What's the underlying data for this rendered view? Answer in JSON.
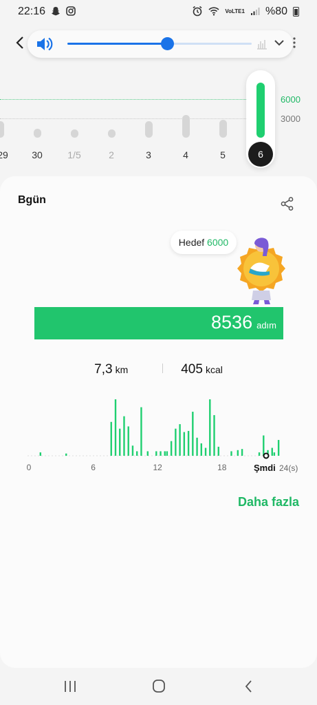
{
  "status_bar": {
    "time": "22:16",
    "notif_icons": [
      "snapchat-icon",
      "instagram-icon"
    ],
    "right_icons": [
      "alarm-icon",
      "wifi-icon",
      "volte-icon",
      "signal-icon"
    ],
    "volte_text": "VoLTE1",
    "battery": "%80"
  },
  "volume_slider": {
    "level_fraction": 0.54,
    "accent": "#1a73e8"
  },
  "week_chart": {
    "goal_value": "6000",
    "mid_value": "3000",
    "days": [
      "29",
      "30",
      "1/5",
      "2",
      "3",
      "4",
      "5",
      "6"
    ],
    "day_values": [
      2600,
      1400,
      1200,
      800,
      2600,
      3500,
      2800,
      8536
    ],
    "selected_index": 7,
    "dim_indices": [
      2,
      3
    ],
    "accent": "#1fcf70"
  },
  "today": {
    "title": "Bgün",
    "goal_label": "Hedef",
    "goal_value": "6000",
    "steps": "8536",
    "steps_unit": "adım",
    "distance": "7,3",
    "distance_unit": "km",
    "calories": "405",
    "calories_unit": "kcal",
    "more_label": "Daha fazla"
  },
  "hourly_chart": {
    "x_ticks": [
      "0",
      "6",
      "12",
      "18"
    ],
    "now_label": "Şmdi",
    "end_label": "24(s)",
    "bars": [
      [
        1.0,
        6
      ],
      [
        3.4,
        4
      ],
      [
        7.6,
        60
      ],
      [
        8.0,
        100
      ],
      [
        8.4,
        48
      ],
      [
        8.8,
        70
      ],
      [
        9.2,
        52
      ],
      [
        9.6,
        18
      ],
      [
        10.0,
        8
      ],
      [
        10.4,
        86
      ],
      [
        11.0,
        8
      ],
      [
        11.8,
        8
      ],
      [
        12.2,
        8
      ],
      [
        12.6,
        8
      ],
      [
        12.8,
        8
      ],
      [
        13.2,
        26
      ],
      [
        13.6,
        48
      ],
      [
        14.0,
        56
      ],
      [
        14.4,
        42
      ],
      [
        14.8,
        44
      ],
      [
        15.2,
        78
      ],
      [
        15.6,
        32
      ],
      [
        16.0,
        22
      ],
      [
        16.4,
        14
      ],
      [
        16.8,
        100
      ],
      [
        17.2,
        72
      ],
      [
        17.6,
        16
      ],
      [
        18.8,
        8
      ],
      [
        19.4,
        10
      ],
      [
        19.8,
        12
      ],
      [
        21.4,
        6
      ],
      [
        21.8,
        36
      ],
      [
        22.2,
        10
      ],
      [
        22.6,
        14
      ],
      [
        22.8,
        6
      ],
      [
        23.2,
        28
      ]
    ]
  },
  "nav_bar": {
    "buttons": [
      "recents-icon",
      "home-icon",
      "back-icon"
    ]
  }
}
